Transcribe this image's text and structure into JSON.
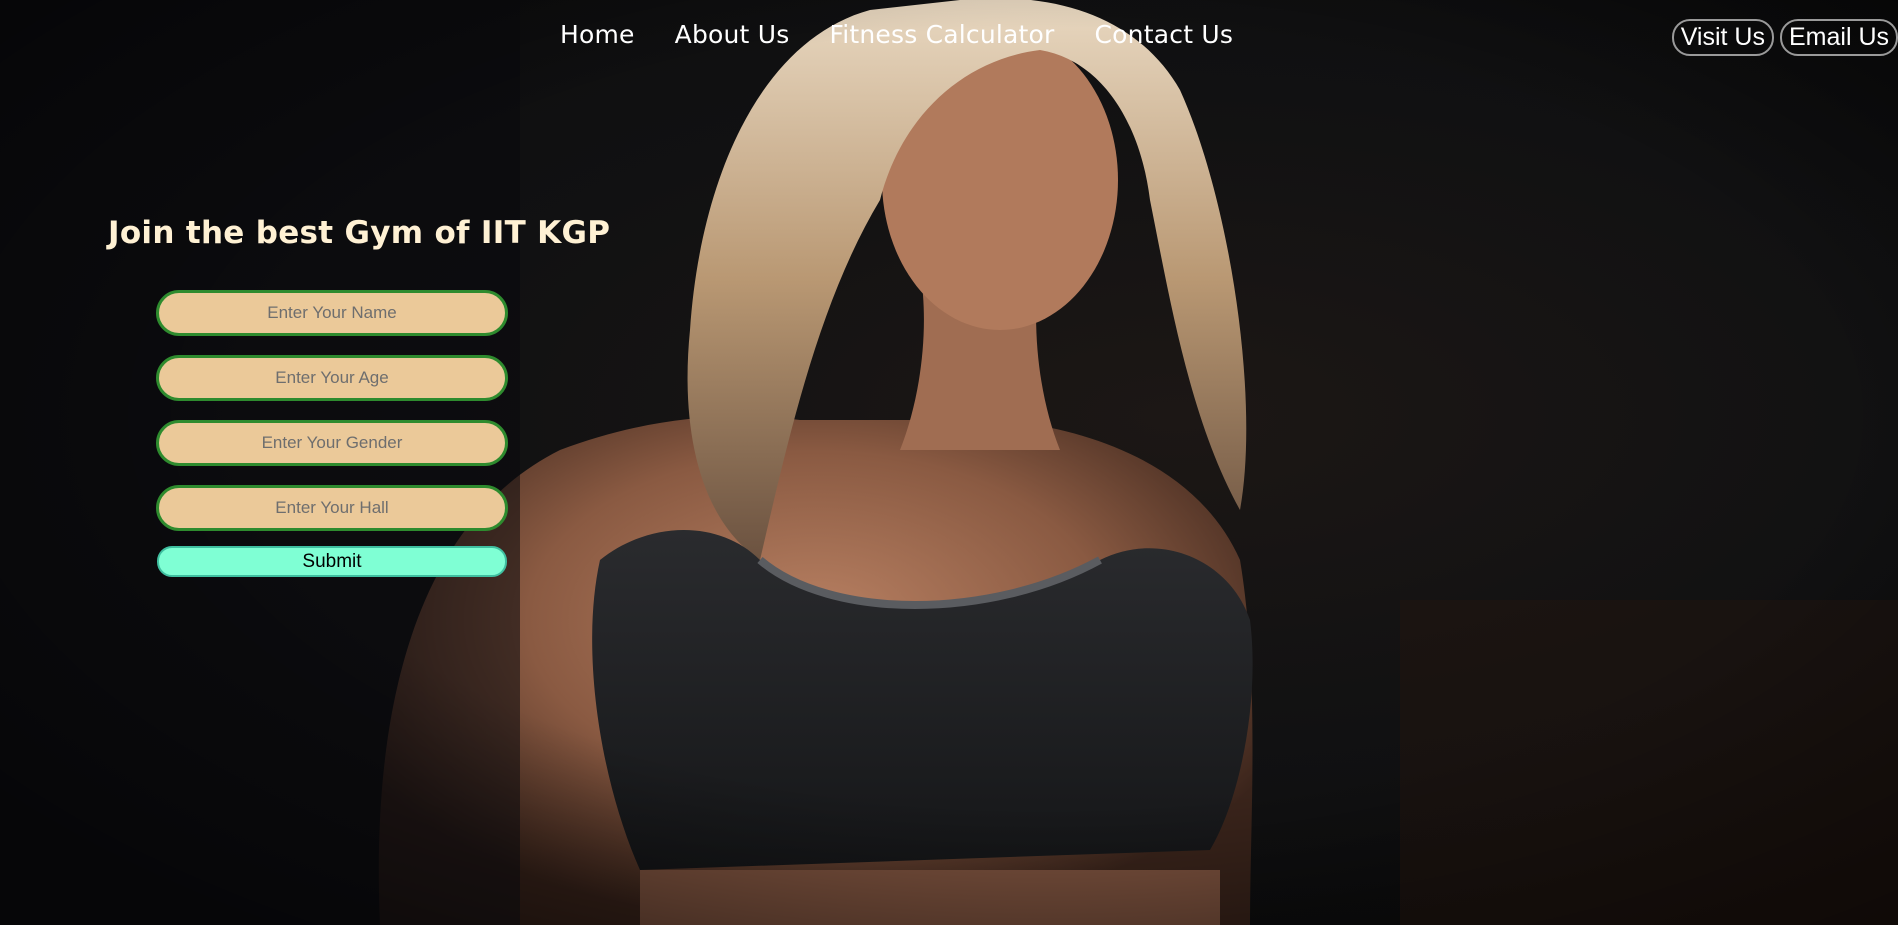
{
  "nav": {
    "links": [
      {
        "label": "Home"
      },
      {
        "label": "About Us"
      },
      {
        "label": "Fitness Calculator"
      },
      {
        "label": "Contact Us"
      }
    ],
    "visit_label": "Visit Us",
    "email_label": "Email Us"
  },
  "hero": {
    "title": "Join the best Gym of IIT KGP"
  },
  "form": {
    "name_placeholder": "Enter Your Name",
    "age_placeholder": "Enter Your Age",
    "gender_placeholder": "Enter Your Gender",
    "hall_placeholder": "Enter Your Hall",
    "submit_label": "Submit"
  },
  "colors": {
    "field_bg": "#ebc999",
    "field_border": "#2e8b2e",
    "submit_bg": "#7fffd4",
    "title_color": "#fff1d4",
    "background": "#0e0e10"
  }
}
